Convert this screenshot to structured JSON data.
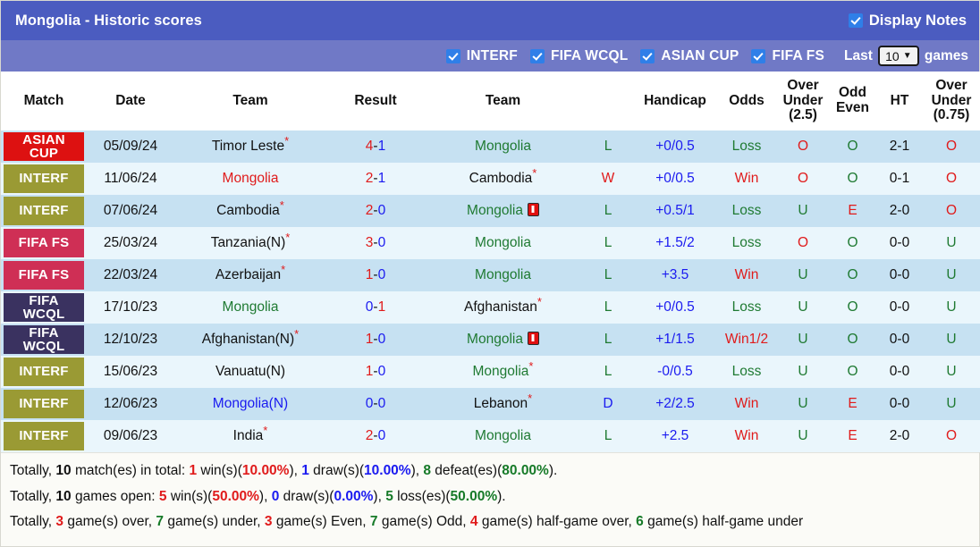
{
  "header": {
    "title": "Mongolia - Historic scores",
    "display_notes_label": "Display Notes",
    "display_notes_checked": true
  },
  "filters": {
    "items": [
      {
        "label": "INTERF",
        "checked": true
      },
      {
        "label": "FIFA WCQL",
        "checked": true
      },
      {
        "label": "ASIAN CUP",
        "checked": true
      },
      {
        "label": "FIFA FS",
        "checked": true
      }
    ],
    "last_label": "Last",
    "last_value": "10",
    "games_label": "games"
  },
  "columns": [
    {
      "key": "match",
      "label": "Match"
    },
    {
      "key": "date",
      "label": "Date"
    },
    {
      "key": "home",
      "label": "Team"
    },
    {
      "key": "result",
      "label": "Result"
    },
    {
      "key": "away",
      "label": "Team"
    },
    {
      "key": "wld",
      "label": ""
    },
    {
      "key": "handicap",
      "label": "Handicap"
    },
    {
      "key": "odds",
      "label": "Odds"
    },
    {
      "key": "ou25",
      "label": "Over\nUnder\n(2.5)"
    },
    {
      "key": "oddeven",
      "label": "Odd\nEven"
    },
    {
      "key": "ht",
      "label": "HT"
    },
    {
      "key": "ou075",
      "label": "Over\nUnder\n(0.75)"
    }
  ],
  "badge_colors": {
    "ASIAN CUP": "#dd1111",
    "INTERF": "#9a9a34",
    "FIFA FS": "#cf2f55",
    "FIFA WCQL": "#3a3260"
  },
  "rows": [
    {
      "comp": "ASIAN CUP",
      "comp_lines": [
        "ASIAN",
        "CUP"
      ],
      "badge_color": "#dd1111",
      "date": "05/09/24",
      "home": "Timor Leste",
      "home_star": true,
      "home_color": "#111111",
      "home_redcard": false,
      "result": "4-1",
      "result_left_color": "#e01b1b",
      "result_right_color": "#1a1af0",
      "away": "Mongolia",
      "away_star": false,
      "away_color": "#1f7a32",
      "away_redcard": false,
      "wld": "L",
      "wld_color": "#1f7a32",
      "handicap": "+0/0.5",
      "odds": "Loss",
      "odds_color": "#1f7a32",
      "ou25": "O",
      "ou25_color": "#e01b1b",
      "oddeven": "O",
      "oddeven_color": "#1f7a32",
      "ht": "2-1",
      "ou075": "O",
      "ou075_color": "#e01b1b"
    },
    {
      "comp": "INTERF",
      "comp_lines": [
        "INTERF"
      ],
      "badge_color": "#9a9a34",
      "date": "11/06/24",
      "home": "Mongolia",
      "home_star": false,
      "home_color": "#e01b1b",
      "home_redcard": false,
      "result": "2-1",
      "result_left_color": "#e01b1b",
      "result_right_color": "#1a1af0",
      "away": "Cambodia",
      "away_star": true,
      "away_color": "#111111",
      "away_redcard": false,
      "wld": "W",
      "wld_color": "#e01b1b",
      "handicap": "+0/0.5",
      "odds": "Win",
      "odds_color": "#e01b1b",
      "ou25": "O",
      "ou25_color": "#e01b1b",
      "oddeven": "O",
      "oddeven_color": "#1f7a32",
      "ht": "0-1",
      "ou075": "O",
      "ou075_color": "#e01b1b"
    },
    {
      "comp": "INTERF",
      "comp_lines": [
        "INTERF"
      ],
      "badge_color": "#9a9a34",
      "date": "07/06/24",
      "home": "Cambodia",
      "home_star": true,
      "home_color": "#111111",
      "home_redcard": false,
      "result": "2-0",
      "result_left_color": "#e01b1b",
      "result_right_color": "#1a1af0",
      "away": "Mongolia",
      "away_star": false,
      "away_color": "#1f7a32",
      "away_redcard": true,
      "wld": "L",
      "wld_color": "#1f7a32",
      "handicap": "+0.5/1",
      "odds": "Loss",
      "odds_color": "#1f7a32",
      "ou25": "U",
      "ou25_color": "#1f7a32",
      "oddeven": "E",
      "oddeven_color": "#e01b1b",
      "ht": "2-0",
      "ou075": "O",
      "ou075_color": "#e01b1b"
    },
    {
      "comp": "FIFA FS",
      "comp_lines": [
        "FIFA FS"
      ],
      "badge_color": "#cf2f55",
      "date": "25/03/24",
      "home": "Tanzania(N)",
      "home_star": true,
      "home_color": "#111111",
      "home_redcard": false,
      "result": "3-0",
      "result_left_color": "#e01b1b",
      "result_right_color": "#1a1af0",
      "away": "Mongolia",
      "away_star": false,
      "away_color": "#1f7a32",
      "away_redcard": false,
      "wld": "L",
      "wld_color": "#1f7a32",
      "handicap": "+1.5/2",
      "odds": "Loss",
      "odds_color": "#1f7a32",
      "ou25": "O",
      "ou25_color": "#e01b1b",
      "oddeven": "O",
      "oddeven_color": "#1f7a32",
      "ht": "0-0",
      "ou075": "U",
      "ou075_color": "#1f7a32"
    },
    {
      "comp": "FIFA FS",
      "comp_lines": [
        "FIFA FS"
      ],
      "badge_color": "#cf2f55",
      "date": "22/03/24",
      "home": "Azerbaijan",
      "home_star": true,
      "home_color": "#111111",
      "home_redcard": false,
      "result": "1-0",
      "result_left_color": "#e01b1b",
      "result_right_color": "#1a1af0",
      "away": "Mongolia",
      "away_star": false,
      "away_color": "#1f7a32",
      "away_redcard": false,
      "wld": "L",
      "wld_color": "#1f7a32",
      "handicap": "+3.5",
      "odds": "Win",
      "odds_color": "#e01b1b",
      "ou25": "U",
      "ou25_color": "#1f7a32",
      "oddeven": "O",
      "oddeven_color": "#1f7a32",
      "ht": "0-0",
      "ou075": "U",
      "ou075_color": "#1f7a32"
    },
    {
      "comp": "FIFA WCQL",
      "comp_lines": [
        "FIFA",
        "WCQL"
      ],
      "badge_color": "#3a3260",
      "date": "17/10/23",
      "home": "Mongolia",
      "home_star": false,
      "home_color": "#1f7a32",
      "home_redcard": false,
      "result": "0-1",
      "result_left_color": "#1a1af0",
      "result_right_color": "#e01b1b",
      "away": "Afghanistan",
      "away_star": true,
      "away_color": "#111111",
      "away_redcard": false,
      "wld": "L",
      "wld_color": "#1f7a32",
      "handicap": "+0/0.5",
      "odds": "Loss",
      "odds_color": "#1f7a32",
      "ou25": "U",
      "ou25_color": "#1f7a32",
      "oddeven": "O",
      "oddeven_color": "#1f7a32",
      "ht": "0-0",
      "ou075": "U",
      "ou075_color": "#1f7a32"
    },
    {
      "comp": "FIFA WCQL",
      "comp_lines": [
        "FIFA",
        "WCQL"
      ],
      "badge_color": "#3a3260",
      "date": "12/10/23",
      "home": "Afghanistan(N)",
      "home_star": true,
      "home_color": "#111111",
      "home_redcard": false,
      "result": "1-0",
      "result_left_color": "#e01b1b",
      "result_right_color": "#1a1af0",
      "away": "Mongolia",
      "away_star": false,
      "away_color": "#1f7a32",
      "away_redcard": true,
      "wld": "L",
      "wld_color": "#1f7a32",
      "handicap": "+1/1.5",
      "odds": "Win1/2",
      "odds_color": "#e01b1b",
      "ou25": "U",
      "ou25_color": "#1f7a32",
      "oddeven": "O",
      "oddeven_color": "#1f7a32",
      "ht": "0-0",
      "ou075": "U",
      "ou075_color": "#1f7a32"
    },
    {
      "comp": "INTERF",
      "comp_lines": [
        "INTERF"
      ],
      "badge_color": "#9a9a34",
      "date": "15/06/23",
      "home": "Vanuatu(N)",
      "home_star": false,
      "home_color": "#111111",
      "home_redcard": false,
      "result": "1-0",
      "result_left_color": "#e01b1b",
      "result_right_color": "#1a1af0",
      "away": "Mongolia",
      "away_star": true,
      "away_color": "#1f7a32",
      "away_redcard": false,
      "wld": "L",
      "wld_color": "#1f7a32",
      "handicap": "-0/0.5",
      "odds": "Loss",
      "odds_color": "#1f7a32",
      "ou25": "U",
      "ou25_color": "#1f7a32",
      "oddeven": "O",
      "oddeven_color": "#1f7a32",
      "ht": "0-0",
      "ou075": "U",
      "ou075_color": "#1f7a32"
    },
    {
      "comp": "INTERF",
      "comp_lines": [
        "INTERF"
      ],
      "badge_color": "#9a9a34",
      "date": "12/06/23",
      "home": "Mongolia(N)",
      "home_star": false,
      "home_color": "#1a1af0",
      "home_redcard": false,
      "result": "0-0",
      "result_left_color": "#1a1af0",
      "result_right_color": "#1a1af0",
      "away": "Lebanon",
      "away_star": true,
      "away_color": "#111111",
      "away_redcard": false,
      "wld": "D",
      "wld_color": "#1a1af0",
      "handicap": "+2/2.5",
      "odds": "Win",
      "odds_color": "#e01b1b",
      "ou25": "U",
      "ou25_color": "#1f7a32",
      "oddeven": "E",
      "oddeven_color": "#e01b1b",
      "ht": "0-0",
      "ou075": "U",
      "ou075_color": "#1f7a32"
    },
    {
      "comp": "INTERF",
      "comp_lines": [
        "INTERF"
      ],
      "badge_color": "#9a9a34",
      "date": "09/06/23",
      "home": "India",
      "home_star": true,
      "home_color": "#111111",
      "home_redcard": false,
      "result": "2-0",
      "result_left_color": "#e01b1b",
      "result_right_color": "#1a1af0",
      "away": "Mongolia",
      "away_star": false,
      "away_color": "#1f7a32",
      "away_redcard": false,
      "wld": "L",
      "wld_color": "#1f7a32",
      "handicap": "+2.5",
      "odds": "Win",
      "odds_color": "#e01b1b",
      "ou25": "U",
      "ou25_color": "#1f7a32",
      "oddeven": "E",
      "oddeven_color": "#e01b1b",
      "ht": "2-0",
      "ou075": "O",
      "ou075_color": "#e01b1b"
    }
  ],
  "summary": {
    "line1": {
      "parts": [
        {
          "t": "Totally, ",
          "c": "plain"
        },
        {
          "t": "10",
          "c": "black"
        },
        {
          "t": " match(es) in total: ",
          "c": "plain"
        },
        {
          "t": "1",
          "c": "red"
        },
        {
          "t": " win(s)(",
          "c": "plain"
        },
        {
          "t": "10.00%",
          "c": "red"
        },
        {
          "t": "), ",
          "c": "plain"
        },
        {
          "t": "1",
          "c": "blue"
        },
        {
          "t": " draw(s)(",
          "c": "plain"
        },
        {
          "t": "10.00%",
          "c": "blue"
        },
        {
          "t": "), ",
          "c": "plain"
        },
        {
          "t": "8",
          "c": "green"
        },
        {
          "t": " defeat(es)(",
          "c": "plain"
        },
        {
          "t": "80.00%",
          "c": "green"
        },
        {
          "t": ").",
          "c": "plain"
        }
      ]
    },
    "line2": {
      "parts": [
        {
          "t": "Totally, ",
          "c": "plain"
        },
        {
          "t": "10",
          "c": "black"
        },
        {
          "t": " games open: ",
          "c": "plain"
        },
        {
          "t": "5",
          "c": "red"
        },
        {
          "t": " win(s)(",
          "c": "plain"
        },
        {
          "t": "50.00%",
          "c": "red"
        },
        {
          "t": "), ",
          "c": "plain"
        },
        {
          "t": "0",
          "c": "blue"
        },
        {
          "t": " draw(s)(",
          "c": "plain"
        },
        {
          "t": "0.00%",
          "c": "blue"
        },
        {
          "t": "), ",
          "c": "plain"
        },
        {
          "t": "5",
          "c": "green"
        },
        {
          "t": " loss(es)(",
          "c": "plain"
        },
        {
          "t": "50.00%",
          "c": "green"
        },
        {
          "t": ").",
          "c": "plain"
        }
      ]
    },
    "line3": {
      "parts": [
        {
          "t": "Totally, ",
          "c": "plain"
        },
        {
          "t": "3",
          "c": "red"
        },
        {
          "t": " game(s) over, ",
          "c": "plain"
        },
        {
          "t": "7",
          "c": "green"
        },
        {
          "t": " game(s) under, ",
          "c": "plain"
        },
        {
          "t": "3",
          "c": "red"
        },
        {
          "t": " game(s) Even, ",
          "c": "plain"
        },
        {
          "t": "7",
          "c": "green"
        },
        {
          "t": " game(s) Odd, ",
          "c": "plain"
        },
        {
          "t": "4",
          "c": "red"
        },
        {
          "t": " game(s) half-game over, ",
          "c": "plain"
        },
        {
          "t": "6",
          "c": "green"
        },
        {
          "t": " game(s) half-game under",
          "c": "plain"
        }
      ]
    }
  }
}
